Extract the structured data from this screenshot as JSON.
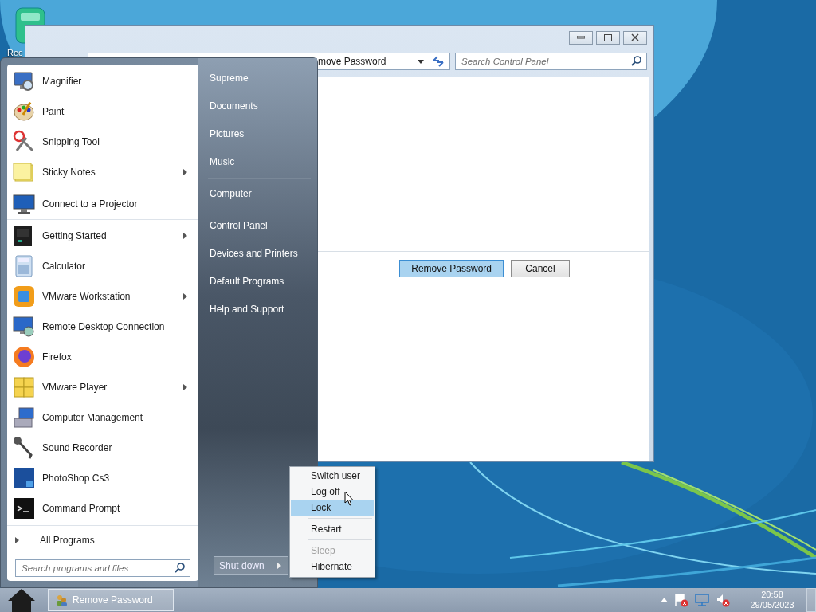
{
  "desktop_icons": [
    {
      "label": "Rec"
    }
  ],
  "window": {
    "address": "move Password",
    "search": {
      "placeholder": "Search Control Panel"
    },
    "buttons": [
      {
        "label": "Remove Password",
        "selected": true
      },
      {
        "label": "Cancel",
        "selected": false
      }
    ]
  },
  "start_menu": {
    "programs": [
      {
        "label": "Magnifier",
        "submenu": false,
        "separator_after": false
      },
      {
        "label": "Paint",
        "submenu": false,
        "separator_after": false
      },
      {
        "label": "Snipping Tool",
        "submenu": false,
        "separator_after": false
      },
      {
        "label": "Sticky Notes",
        "submenu": true,
        "separator_after": false
      },
      {
        "label": "Connect to a Projector",
        "submenu": false,
        "separator_after": true
      },
      {
        "label": "Getting Started",
        "submenu": true,
        "separator_after": false
      },
      {
        "label": "Calculator",
        "submenu": false,
        "separator_after": false
      },
      {
        "label": "VMware Workstation",
        "submenu": true,
        "separator_after": false
      },
      {
        "label": "Remote Desktop Connection",
        "submenu": false,
        "separator_after": false
      },
      {
        "label": "Firefox",
        "submenu": false,
        "separator_after": false
      },
      {
        "label": "VMware Player",
        "submenu": true,
        "separator_after": false
      },
      {
        "label": "Computer Management",
        "submenu": false,
        "separator_after": false
      },
      {
        "label": "Sound Recorder",
        "submenu": false,
        "separator_after": false
      },
      {
        "label": "PhotoShop Cs3",
        "submenu": false,
        "separator_after": false
      },
      {
        "label": "Command Prompt",
        "submenu": false,
        "separator_after": false
      }
    ],
    "all_programs": "All Programs",
    "search": {
      "placeholder": "Search programs and files"
    },
    "places": [
      {
        "label": "Supreme",
        "separator_after": false
      },
      {
        "label": "Documents",
        "separator_after": false
      },
      {
        "label": "Pictures",
        "separator_after": false
      },
      {
        "label": "Music",
        "separator_after": true
      },
      {
        "label": "Computer",
        "separator_after": true
      },
      {
        "label": "Control Panel",
        "separator_after": false
      },
      {
        "label": "Devices and Printers",
        "separator_after": false
      },
      {
        "label": "Default Programs",
        "separator_after": false
      },
      {
        "label": "Help and Support",
        "separator_after": false
      }
    ],
    "shutdown": {
      "label": "Shut down"
    }
  },
  "power_menu": [
    {
      "label": "Switch user",
      "selected": false,
      "disabled": false,
      "separator_after": false
    },
    {
      "label": "Log off",
      "selected": false,
      "disabled": false,
      "separator_after": false
    },
    {
      "label": "Lock",
      "selected": true,
      "disabled": false,
      "separator_after": true
    },
    {
      "label": "Restart",
      "selected": false,
      "disabled": false,
      "separator_after": true
    },
    {
      "label": "Sleep",
      "selected": false,
      "disabled": true,
      "separator_after": false
    },
    {
      "label": "Hibernate",
      "selected": false,
      "disabled": false,
      "separator_after": false
    }
  ],
  "taskbar": {
    "buttons": [
      {
        "label": "Remove Password"
      }
    ],
    "clock": {
      "time": "20:58",
      "date": "29/05/2023"
    }
  }
}
